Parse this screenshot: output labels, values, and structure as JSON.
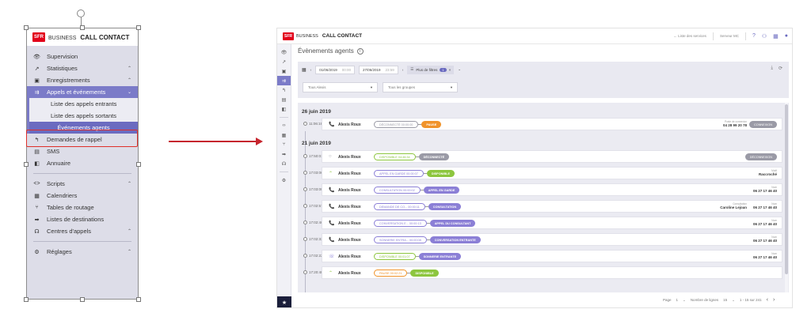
{
  "menu": {
    "brand_logo": "SFR",
    "brand_business": "BUSINESS",
    "brand_product": "CALL CONTACT",
    "items": [
      {
        "label": "Supervision",
        "icon": "eye-icon",
        "glyph": "👁",
        "chevron": ""
      },
      {
        "label": "Statistiques",
        "icon": "trend-icon",
        "glyph": "↗",
        "chevron": "▲"
      },
      {
        "label": "Enregistrements",
        "icon": "save-icon",
        "glyph": "▣",
        "chevron": "▲"
      },
      {
        "label": "Appels et événements",
        "icon": "events-icon",
        "glyph": "⇉",
        "chevron": "▼"
      }
    ],
    "sub_items": [
      "Liste des appels entrants",
      "Liste des appels sortants",
      "Événements agents"
    ],
    "items2": [
      {
        "label": "Demandes de rappel",
        "icon": "callback-icon",
        "glyph": "↰",
        "chevron": ""
      },
      {
        "label": "SMS",
        "icon": "sms-icon",
        "glyph": "▤",
        "chevron": ""
      },
      {
        "label": "Annuaire",
        "icon": "book-icon",
        "glyph": "◧",
        "chevron": ""
      }
    ],
    "items3": [
      {
        "label": "Scripts",
        "icon": "code-icon",
        "glyph": "<>",
        "chevron": "▲"
      },
      {
        "label": "Calendriers",
        "icon": "calendar-icon",
        "glyph": "▦",
        "chevron": ""
      },
      {
        "label": "Tables de routage",
        "icon": "route-icon",
        "glyph": "⑂",
        "chevron": ""
      },
      {
        "label": "Listes de destinations",
        "icon": "destination-icon",
        "glyph": "➡",
        "chevron": ""
      },
      {
        "label": "Centres d'appels",
        "icon": "headset-icon",
        "glyph": "☊",
        "chevron": "▲"
      }
    ],
    "items4": [
      {
        "label": "Réglages",
        "icon": "gear-icon",
        "glyph": "⚙",
        "chevron": "▲"
      }
    ]
  },
  "app": {
    "brand_logo": "SFR",
    "brand_business": "BUSINESS",
    "brand_product": "CALL CONTACT",
    "topbar": {
      "services_link": "← Liste des services",
      "service_name": "Serveur MC"
    },
    "page_title": "Évènements agents",
    "filters": {
      "date_from": "01/06/2019",
      "time_from": "00:00",
      "date_to": "27/06/2019",
      "time_to": "23:59",
      "more_filters": "Plus de filtres",
      "filter_count": "1",
      "agents_select": "Tous Alexis",
      "groups_select": "Tous les groupes"
    },
    "days": [
      {
        "label": "26 juin 2019"
      },
      {
        "label": "21 juin 2019"
      }
    ],
    "events": [
      {
        "time": "11:06:19",
        "agent": "Alexis Roux",
        "icon_glyph": "📞",
        "icon_color": "#e07b20",
        "states": [
          {
            "label": "DÉCONNECTÉ",
            "dur": "00:00:00",
            "style": "out",
            "color": "#9a9aa6"
          },
          {
            "label": "PAUSE",
            "dur": "",
            "style": "fill",
            "color": "#f0932b"
          }
        ],
        "info_label": "Poste de connexion",
        "info_value": "04 28 99 20 78",
        "badge": "CONNEXION"
      },
      {
        "time": "17:50:01",
        "agent": "Alexis Roux",
        "icon_glyph": "○",
        "icon_color": "#9a9aa6",
        "states": [
          {
            "label": "DISPONIBLE",
            "dur": "04:46:34",
            "style": "out",
            "color": "#8dc63f"
          },
          {
            "label": "DÉCONNECTÉ",
            "dur": "",
            "style": "fill",
            "color": "#9a9aa6"
          }
        ],
        "info_label": "",
        "info_value": "",
        "badge": "DÉCONNEXION"
      },
      {
        "time": "17:03:06",
        "agent": "Alexis Roux",
        "icon_glyph": "⌃",
        "icon_color": "#8dc63f",
        "states": [
          {
            "label": "APPEL EN GARDE",
            "dur": "00:00:07",
            "style": "out",
            "color": "#8b7fd6"
          },
          {
            "label": "DISPONIBLE",
            "dur": "",
            "style": "fill",
            "color": "#8dc63f"
          }
        ],
        "info_label": "Motif",
        "info_value": "Raccroché",
        "badge": ""
      },
      {
        "time": "17:03:00",
        "agent": "Alexis Roux",
        "icon_glyph": "📞",
        "icon_color": "#8b7fd6",
        "states": [
          {
            "label": "CONSULTATION",
            "dur": "00:00:02",
            "style": "out",
            "color": "#8b7fd6"
          },
          {
            "label": "APPEL EN GARDE",
            "dur": "",
            "style": "fill",
            "color": "#8b7fd6"
          }
        ],
        "info_label": "Num",
        "info_value": "06 27 17 46 40",
        "badge": ""
      },
      {
        "time": "17:02:57",
        "agent": "Alexis Roux",
        "icon_glyph": "📞",
        "icon_color": "#8b7fd6",
        "states": [
          {
            "label": "DEMANDE DE CO...",
            "dur": "00:00:11",
            "style": "out",
            "color": "#8b7fd6"
          },
          {
            "label": "CONSULTATION",
            "dur": "",
            "style": "fill",
            "color": "#8b7fd6"
          }
        ],
        "info_label": "Consultation",
        "info_value": "Caroline Lejoan",
        "info_label2": "Num",
        "info_value2": "06 27 17 46 40",
        "badge": ""
      },
      {
        "time": "17:02:46",
        "agent": "Alexis Roux",
        "icon_glyph": "📞",
        "icon_color": "#8b7fd6",
        "states": [
          {
            "label": "CONVERSATION E...",
            "dur": "00:00:13",
            "style": "out",
            "color": "#8b7fd6"
          },
          {
            "label": "APPEL DU CONSULTANT",
            "dur": "",
            "style": "fill",
            "color": "#8b7fd6"
          }
        ],
        "info_label": "Num",
        "info_value": "06 27 17 46 40",
        "badge": ""
      },
      {
        "time": "17:02:33",
        "agent": "Alexis Roux",
        "icon_glyph": "📞",
        "icon_color": "#8b7fd6",
        "states": [
          {
            "label": "SONNERIE ENTRA...",
            "dur": "00:00:08",
            "style": "out",
            "color": "#8b7fd6"
          },
          {
            "label": "CONVERSATION ENTRANTE",
            "dur": "",
            "style": "fill",
            "color": "#8b7fd6"
          }
        ],
        "info_label": "Num",
        "info_value": "06 27 17 46 40",
        "badge": ""
      },
      {
        "time": "17:02:22",
        "agent": "Alexis Roux",
        "icon_glyph": "☏",
        "icon_color": "#8b7fd6",
        "states": [
          {
            "label": "DISPONIBLE",
            "dur": "00:01:07",
            "style": "out",
            "color": "#8dc63f"
          },
          {
            "label": "SONNERIE ENTRANTE",
            "dur": "",
            "style": "fill",
            "color": "#8b7fd6"
          }
        ],
        "info_label": "Num",
        "info_value": "06 27 17 46 40",
        "badge": ""
      },
      {
        "time": "17:20:48",
        "agent": "Alexis Roux",
        "icon_glyph": "⌃",
        "icon_color": "#8dc63f",
        "states": [
          {
            "label": "PAUSE",
            "dur": "00:02:21",
            "style": "out",
            "color": "#f0932b"
          },
          {
            "label": "DISPONIBLE",
            "dur": "",
            "style": "fill",
            "color": "#8dc63f"
          }
        ],
        "info_label": "",
        "info_value": "",
        "badge": ""
      }
    ],
    "pager": {
      "page_label": "Page",
      "page_value": "1",
      "rows_label": "Nombre de lignes",
      "rows_value": "15",
      "range": "1 - 15 sur 241"
    }
  }
}
